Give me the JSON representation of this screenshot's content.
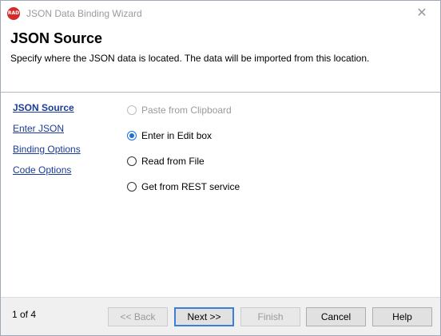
{
  "window": {
    "title": "JSON Data Binding Wizard",
    "app_icon_text": "RAD",
    "close_glyph": "✕"
  },
  "header": {
    "title": "JSON Source",
    "subtitle": "Specify where the JSON data is located. The data will be imported from this location."
  },
  "steps": [
    {
      "label": "JSON Source",
      "active": true
    },
    {
      "label": "Enter JSON",
      "active": false
    },
    {
      "label": "Binding Options",
      "active": false
    },
    {
      "label": "Code Options",
      "active": false
    }
  ],
  "options": [
    {
      "label": "Paste from Clipboard",
      "state": "disabled"
    },
    {
      "label": "Enter in Edit box",
      "state": "checked"
    },
    {
      "label": "Read from File",
      "state": "unchecked"
    },
    {
      "label": "Get from REST service",
      "state": "unchecked"
    }
  ],
  "footer": {
    "page_indicator": "1 of 4",
    "back_label": "<< Back",
    "next_label": "Next >>",
    "finish_label": "Finish",
    "cancel_label": "Cancel",
    "help_label": "Help"
  },
  "colors": {
    "link": "#1a3c99",
    "accent": "#1a6fd6",
    "app_icon": "#d12b2b"
  },
  "icons": {
    "app": "rad-logo-icon",
    "close": "close-icon"
  }
}
